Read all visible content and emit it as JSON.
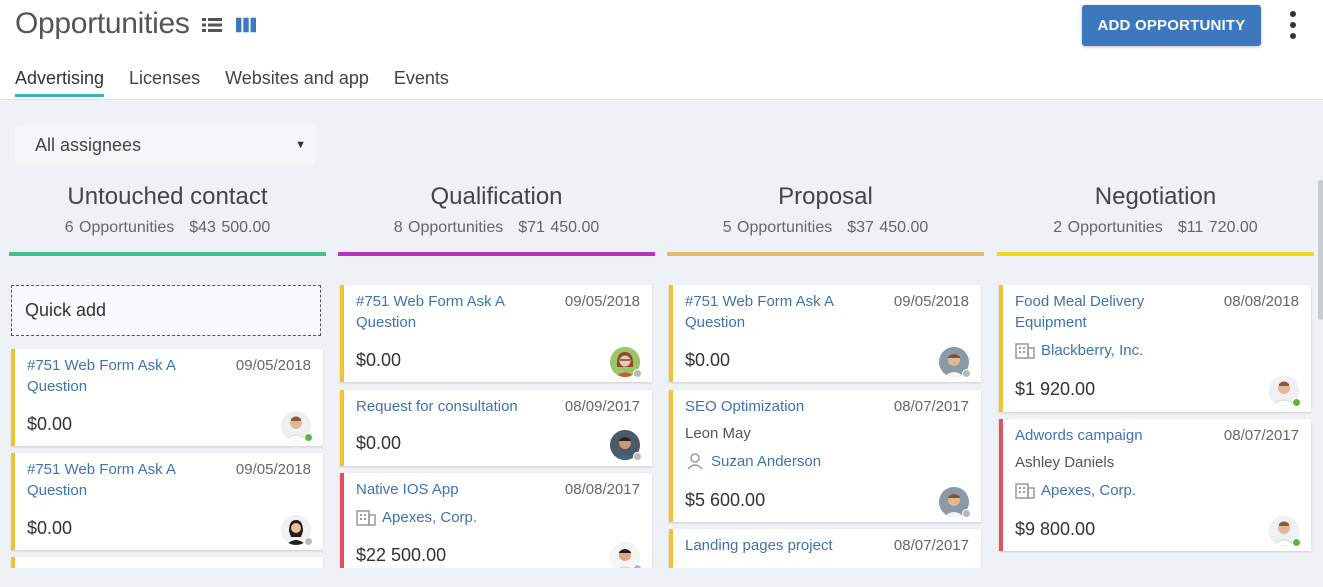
{
  "header": {
    "title": "Opportunities",
    "add_button": "ADD OPPORTUNITY",
    "view_icons": [
      "list-view-icon",
      "board-view-icon"
    ]
  },
  "tabs": [
    {
      "label": "Advertising",
      "active": true
    },
    {
      "label": "Licenses",
      "active": false
    },
    {
      "label": "Websites and app",
      "active": false
    },
    {
      "label": "Events",
      "active": false
    }
  ],
  "filter": {
    "value": "All assignees"
  },
  "colors": {
    "accent": "#3b78bd",
    "tab_underline": "#35b3c3",
    "card_yellow": "#f2c230",
    "card_red": "#e0505e",
    "online": "#5cb83a",
    "offline": "#b8b8b8"
  },
  "columns": [
    {
      "name": "Untouched contact",
      "count": "6 Opportunities",
      "total": "$43 500.00",
      "color": "#3fc38a",
      "quick_add": "Quick add",
      "cards": [
        {
          "title": "#751 Web Form Ask A Question",
          "date": "09/05/2018",
          "amount": "$0.00",
          "status": "online"
        },
        {
          "title": "#751 Web Form Ask A Question",
          "date": "09/05/2018",
          "amount": "$0.00",
          "status": "offline"
        }
      ]
    },
    {
      "name": "Qualification",
      "count": "8 Opportunities",
      "total": "$71 450.00",
      "color": "#b732c2",
      "cards": [
        {
          "title": "#751 Web Form Ask A Question",
          "date": "09/05/2018",
          "amount": "$0.00",
          "status": "offline"
        },
        {
          "title": "Request for consultation",
          "date": "08/09/2017",
          "amount": "$0.00",
          "status": "offline"
        },
        {
          "title": "Native IOS App",
          "date": "08/08/2017",
          "company": "Apexes, Corp.",
          "amount": "$22 500.00",
          "status": "offline"
        }
      ]
    },
    {
      "name": "Proposal",
      "count": "5 Opportunities",
      "total": "$37 450.00",
      "color": "#d9bd6a",
      "cards": [
        {
          "title": "#751 Web Form Ask A Question",
          "date": "09/05/2018",
          "amount": "$0.00",
          "status": "offline"
        },
        {
          "title": "SEO Optimization",
          "date": "08/07/2017",
          "person": "Leon May",
          "contact": "Suzan Anderson",
          "amount": "$5 600.00",
          "status": "offline"
        },
        {
          "title": "Landing pages project",
          "date": "08/07/2017"
        }
      ]
    },
    {
      "name": "Negotiation",
      "count": "2 Opportunities",
      "total": "$11 720.00",
      "color": "#e8dd1c",
      "cards": [
        {
          "title": "Food Meal Delivery Equipment",
          "date": "08/08/2018",
          "company": "Blackberry, Inc.",
          "amount": "$1 920.00",
          "status": "online"
        },
        {
          "title": "Adwords campaign",
          "date": "08/07/2017",
          "person": "Ashley Daniels",
          "company": "Apexes, Corp.",
          "amount": "$9 800.00",
          "status": "online"
        }
      ]
    }
  ]
}
